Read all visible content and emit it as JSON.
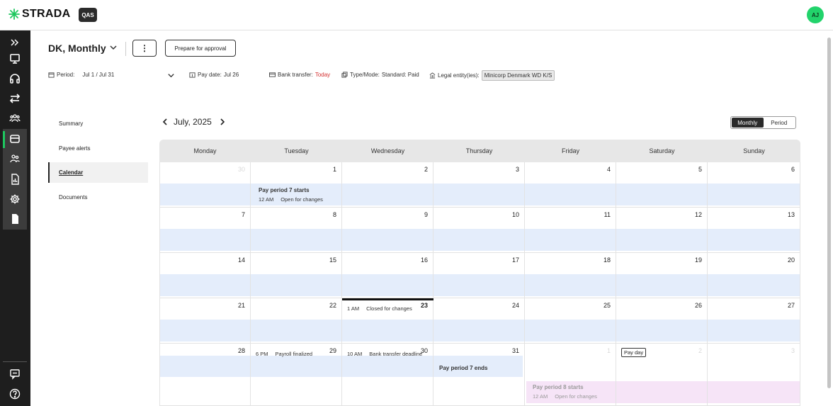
{
  "app": {
    "brand": "STRADA",
    "env_badge": "QAS",
    "user_initials": "AJ",
    "brand_color": "#22d36b"
  },
  "sidenav": {
    "items": [
      {
        "icon": "expand-icon"
      },
      {
        "icon": "monitor-icon"
      },
      {
        "icon": "headset-icon"
      },
      {
        "icon": "transfer-icon"
      },
      {
        "icon": "people-group-icon"
      },
      {
        "icon": "wallet-icon"
      },
      {
        "icon": "people-icon"
      },
      {
        "icon": "report-icon"
      },
      {
        "icon": "gear-icon"
      },
      {
        "icon": "document-icon"
      },
      {
        "icon": "feedback-icon"
      },
      {
        "icon": "help-icon"
      }
    ]
  },
  "header": {
    "title": "DK, Monthly",
    "more_label": "⋮",
    "approval_label": "Prepare for approval"
  },
  "meta": {
    "period_label": "Period:",
    "period_value": "Jul 1 / Jul 31",
    "pay_date_label": "Pay date:",
    "pay_date_value": "Jul 26",
    "bank_transfer_label": "Bank transfer:",
    "bank_transfer_value": "Today",
    "type_mode_label": "Type/Mode:",
    "type_mode_value": "Standard: Paid",
    "legal_entity_label": "Legal entity(ies):",
    "legal_entity_value": "Minicorp Denmark WD K/S"
  },
  "subnav": {
    "items": [
      "Summary",
      "Payee alerts",
      "Calendar",
      "Documents"
    ],
    "active": "Calendar"
  },
  "calendar": {
    "month_label": "July, 2025",
    "view_options": [
      "Monthly",
      "Period"
    ],
    "active_view": "Monthly",
    "weekdays": [
      "Monday",
      "Tuesday",
      "Wednesday",
      "Thursday",
      "Friday",
      "Saturday",
      "Sunday"
    ],
    "weeks": [
      [
        "30",
        "1",
        "2",
        "3",
        "4",
        "5",
        "6"
      ],
      [
        "7",
        "8",
        "9",
        "10",
        "11",
        "12",
        "13"
      ],
      [
        "14",
        "15",
        "16",
        "17",
        "18",
        "19",
        "20"
      ],
      [
        "21",
        "22",
        "23",
        "24",
        "25",
        "26",
        "27"
      ],
      [
        "28",
        "29",
        "30",
        "31",
        "1",
        "2",
        "3"
      ]
    ],
    "today": "23",
    "events": {
      "pay_period_start_title": "Pay period 7 starts",
      "pay_period_start_time": "12 AM",
      "pay_period_start_desc": "Open for changes",
      "closed_time": "1 AM",
      "closed_desc": "Closed for changes",
      "payroll_time": "6 PM",
      "payroll_desc": "Payroll finalized",
      "bank_time": "10 AM",
      "bank_desc": "Bank transfer deadline",
      "pay_day": "Pay day",
      "pay_period_end_title": "Pay period 7 ends",
      "next_period_title": "Pay period 8 starts",
      "next_period_time": "12 AM",
      "next_period_desc": "Open for changes"
    }
  }
}
